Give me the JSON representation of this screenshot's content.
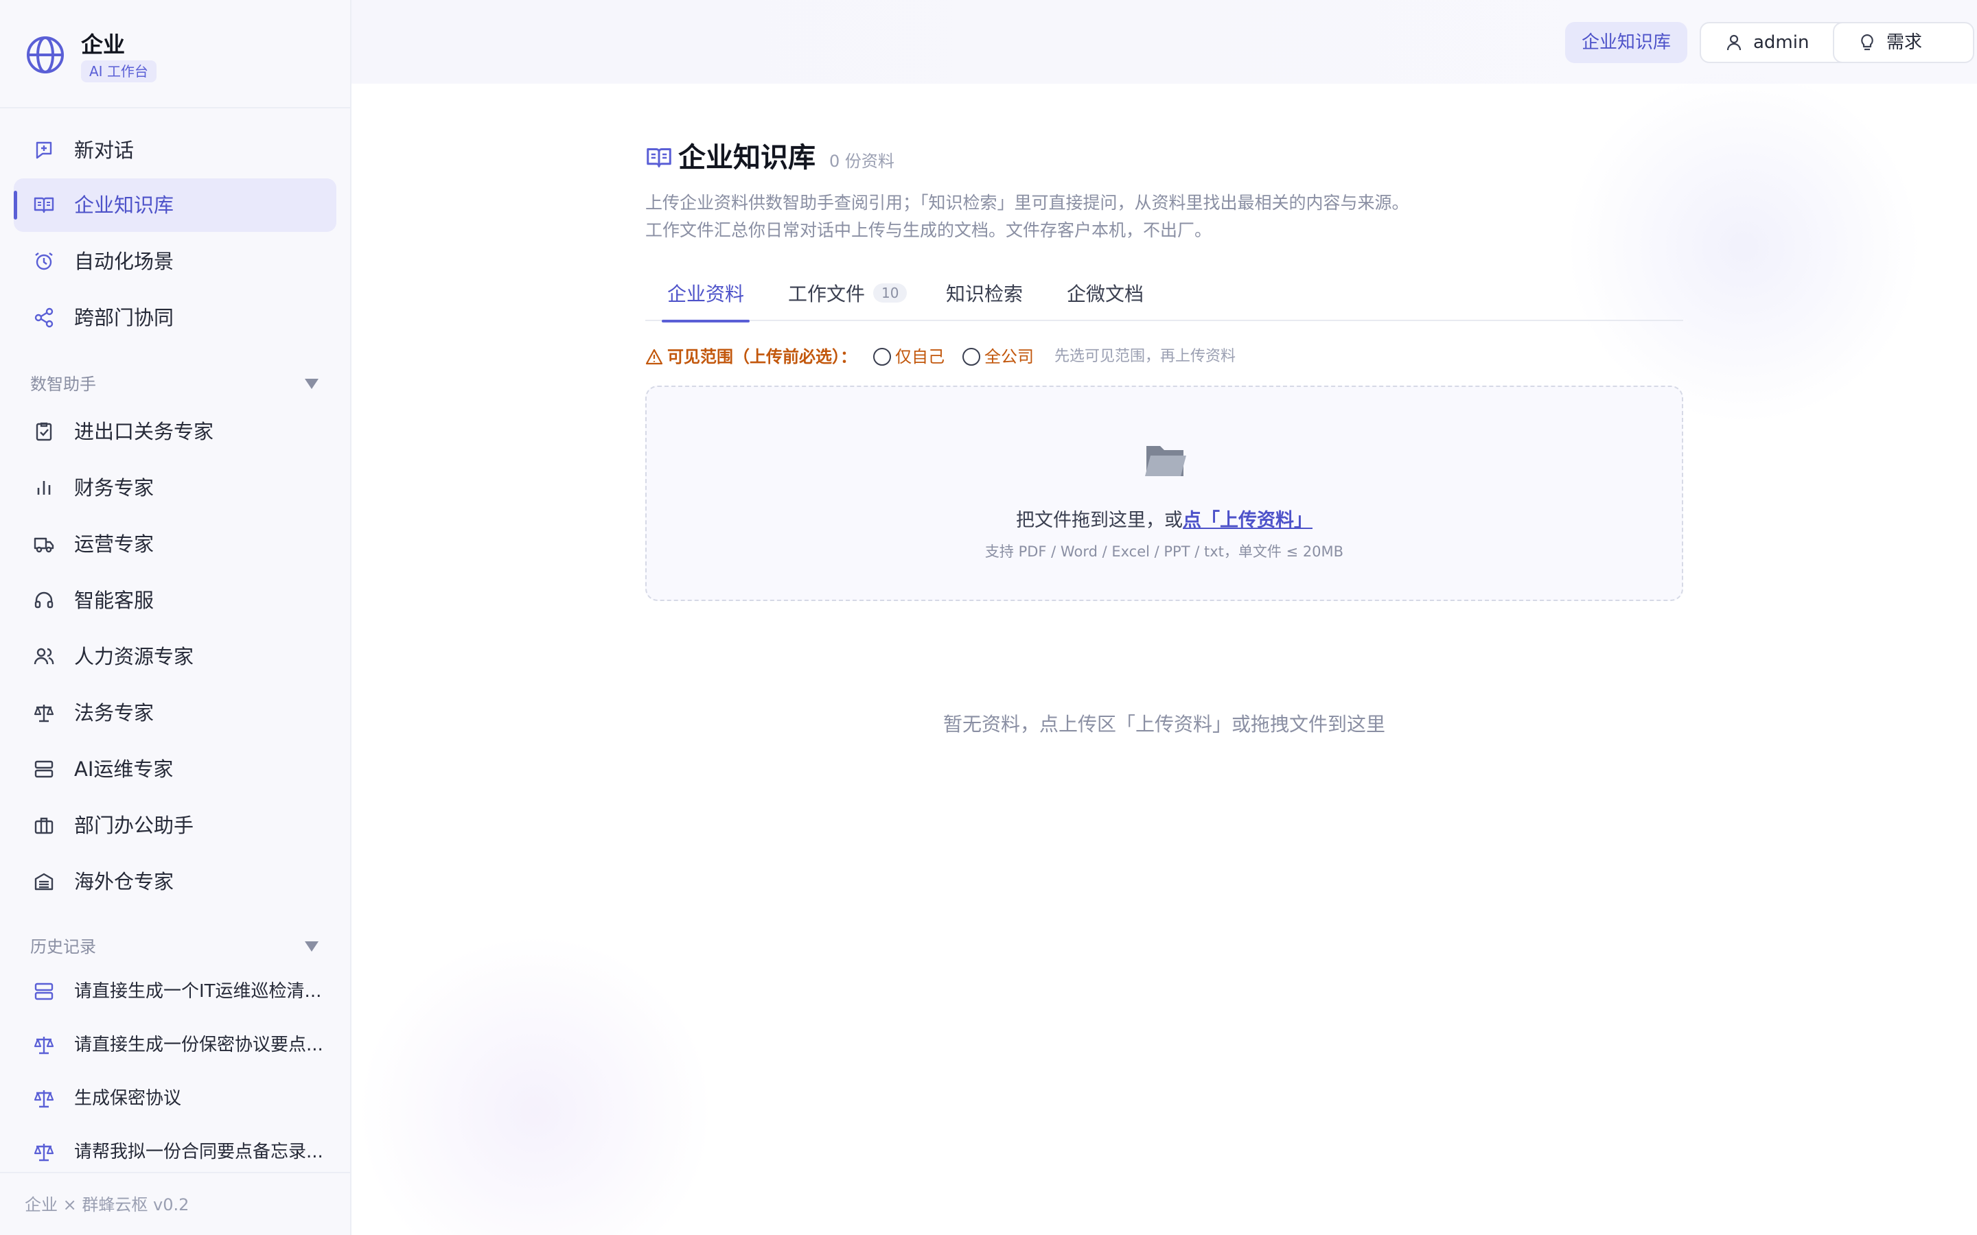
{
  "brand": {
    "name": "企业",
    "tag": "AI 工作台"
  },
  "nav": {
    "top": [
      {
        "label": "新对话",
        "icon": "new-chat-icon"
      },
      {
        "label": "企业知识库",
        "icon": "book-open-icon",
        "active": true
      },
      {
        "label": "自动化场景",
        "icon": "alarm-clock-icon"
      },
      {
        "label": "跨部门协同",
        "icon": "share-icon"
      }
    ],
    "assistants_title": "数智助手",
    "assistants": [
      {
        "label": "进出口关务专家",
        "icon": "clipboard-check-icon"
      },
      {
        "label": "财务专家",
        "icon": "bar-chart-icon"
      },
      {
        "label": "运营专家",
        "icon": "truck-icon"
      },
      {
        "label": "智能客服",
        "icon": "headset-icon"
      },
      {
        "label": "人力资源专家",
        "icon": "users-icon"
      },
      {
        "label": "法务专家",
        "icon": "scale-icon"
      },
      {
        "label": "AI运维专家",
        "icon": "server-icon"
      },
      {
        "label": "部门办公助手",
        "icon": "briefcase-icon"
      },
      {
        "label": "海外仓专家",
        "icon": "warehouse-icon"
      }
    ],
    "history_title": "历史记录",
    "history": [
      {
        "label": "请直接生成一个IT运维巡检清...",
        "icon": "server-icon"
      },
      {
        "label": "请直接生成一份保密协议要点...",
        "icon": "scale-icon"
      },
      {
        "label": "生成保密协议",
        "icon": "scale-icon"
      },
      {
        "label": "请帮我拟一份合同要点备忘录...",
        "icon": "scale-icon"
      }
    ],
    "footer": "企业 × 群蜂云枢 v0.2"
  },
  "header": {
    "kb_button": "企业知识库",
    "user_button": "admin",
    "demand_button": "需求"
  },
  "page": {
    "title": "企业知识库",
    "count": "0 份资料",
    "desc1": "上传企业资料供数智助手查阅引用；「知识检索」里可直接提问，从资料里找出最相关的内容与来源。",
    "desc2": "工作文件汇总你日常对话中上传与生成的文档。文件存客户本机，不出厂。",
    "tabs": [
      {
        "label": "企业资料",
        "active": true
      },
      {
        "label": "工作文件",
        "badge": "10"
      },
      {
        "label": "知识检索"
      },
      {
        "label": "企微文档"
      }
    ],
    "scope": {
      "label": "可见范围（上传前必选）：",
      "option_self": "仅自己",
      "option_company": "全公司",
      "hint": "先选可见范围，再上传资料"
    },
    "dropzone": {
      "text_prefix": "把文件拖到这里，或",
      "link": "点「上传资料」",
      "sub": "支持 PDF / Word / Excel / PPT / txt，单文件 ≤ 20MB"
    },
    "empty": "暂无资料，点上传区「上传资料」或拖拽文件到这里"
  },
  "colors": {
    "accent": "#5a5fd6",
    "accent_bg": "#e9e9fb",
    "warning": "#c2570c",
    "muted": "#8a8fa3"
  }
}
